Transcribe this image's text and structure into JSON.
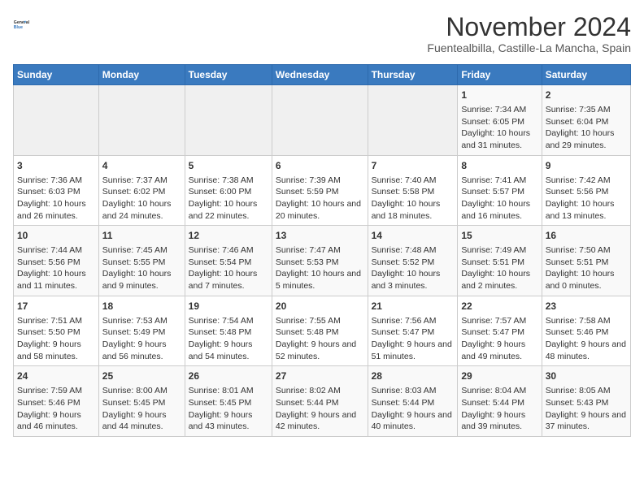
{
  "header": {
    "logo_line1": "General",
    "logo_line2": "Blue",
    "month": "November 2024",
    "location": "Fuentealbilla, Castille-La Mancha, Spain"
  },
  "days_of_week": [
    "Sunday",
    "Monday",
    "Tuesday",
    "Wednesday",
    "Thursday",
    "Friday",
    "Saturday"
  ],
  "weeks": [
    [
      {
        "day": "",
        "info": ""
      },
      {
        "day": "",
        "info": ""
      },
      {
        "day": "",
        "info": ""
      },
      {
        "day": "",
        "info": ""
      },
      {
        "day": "",
        "info": ""
      },
      {
        "day": "1",
        "info": "Sunrise: 7:34 AM\nSunset: 6:05 PM\nDaylight: 10 hours and 31 minutes."
      },
      {
        "day": "2",
        "info": "Sunrise: 7:35 AM\nSunset: 6:04 PM\nDaylight: 10 hours and 29 minutes."
      }
    ],
    [
      {
        "day": "3",
        "info": "Sunrise: 7:36 AM\nSunset: 6:03 PM\nDaylight: 10 hours and 26 minutes."
      },
      {
        "day": "4",
        "info": "Sunrise: 7:37 AM\nSunset: 6:02 PM\nDaylight: 10 hours and 24 minutes."
      },
      {
        "day": "5",
        "info": "Sunrise: 7:38 AM\nSunset: 6:00 PM\nDaylight: 10 hours and 22 minutes."
      },
      {
        "day": "6",
        "info": "Sunrise: 7:39 AM\nSunset: 5:59 PM\nDaylight: 10 hours and 20 minutes."
      },
      {
        "day": "7",
        "info": "Sunrise: 7:40 AM\nSunset: 5:58 PM\nDaylight: 10 hours and 18 minutes."
      },
      {
        "day": "8",
        "info": "Sunrise: 7:41 AM\nSunset: 5:57 PM\nDaylight: 10 hours and 16 minutes."
      },
      {
        "day": "9",
        "info": "Sunrise: 7:42 AM\nSunset: 5:56 PM\nDaylight: 10 hours and 13 minutes."
      }
    ],
    [
      {
        "day": "10",
        "info": "Sunrise: 7:44 AM\nSunset: 5:56 PM\nDaylight: 10 hours and 11 minutes."
      },
      {
        "day": "11",
        "info": "Sunrise: 7:45 AM\nSunset: 5:55 PM\nDaylight: 10 hours and 9 minutes."
      },
      {
        "day": "12",
        "info": "Sunrise: 7:46 AM\nSunset: 5:54 PM\nDaylight: 10 hours and 7 minutes."
      },
      {
        "day": "13",
        "info": "Sunrise: 7:47 AM\nSunset: 5:53 PM\nDaylight: 10 hours and 5 minutes."
      },
      {
        "day": "14",
        "info": "Sunrise: 7:48 AM\nSunset: 5:52 PM\nDaylight: 10 hours and 3 minutes."
      },
      {
        "day": "15",
        "info": "Sunrise: 7:49 AM\nSunset: 5:51 PM\nDaylight: 10 hours and 2 minutes."
      },
      {
        "day": "16",
        "info": "Sunrise: 7:50 AM\nSunset: 5:51 PM\nDaylight: 10 hours and 0 minutes."
      }
    ],
    [
      {
        "day": "17",
        "info": "Sunrise: 7:51 AM\nSunset: 5:50 PM\nDaylight: 9 hours and 58 minutes."
      },
      {
        "day": "18",
        "info": "Sunrise: 7:53 AM\nSunset: 5:49 PM\nDaylight: 9 hours and 56 minutes."
      },
      {
        "day": "19",
        "info": "Sunrise: 7:54 AM\nSunset: 5:48 PM\nDaylight: 9 hours and 54 minutes."
      },
      {
        "day": "20",
        "info": "Sunrise: 7:55 AM\nSunset: 5:48 PM\nDaylight: 9 hours and 52 minutes."
      },
      {
        "day": "21",
        "info": "Sunrise: 7:56 AM\nSunset: 5:47 PM\nDaylight: 9 hours and 51 minutes."
      },
      {
        "day": "22",
        "info": "Sunrise: 7:57 AM\nSunset: 5:47 PM\nDaylight: 9 hours and 49 minutes."
      },
      {
        "day": "23",
        "info": "Sunrise: 7:58 AM\nSunset: 5:46 PM\nDaylight: 9 hours and 48 minutes."
      }
    ],
    [
      {
        "day": "24",
        "info": "Sunrise: 7:59 AM\nSunset: 5:46 PM\nDaylight: 9 hours and 46 minutes."
      },
      {
        "day": "25",
        "info": "Sunrise: 8:00 AM\nSunset: 5:45 PM\nDaylight: 9 hours and 44 minutes."
      },
      {
        "day": "26",
        "info": "Sunrise: 8:01 AM\nSunset: 5:45 PM\nDaylight: 9 hours and 43 minutes."
      },
      {
        "day": "27",
        "info": "Sunrise: 8:02 AM\nSunset: 5:44 PM\nDaylight: 9 hours and 42 minutes."
      },
      {
        "day": "28",
        "info": "Sunrise: 8:03 AM\nSunset: 5:44 PM\nDaylight: 9 hours and 40 minutes."
      },
      {
        "day": "29",
        "info": "Sunrise: 8:04 AM\nSunset: 5:44 PM\nDaylight: 9 hours and 39 minutes."
      },
      {
        "day": "30",
        "info": "Sunrise: 8:05 AM\nSunset: 5:43 PM\nDaylight: 9 hours and 37 minutes."
      }
    ]
  ]
}
